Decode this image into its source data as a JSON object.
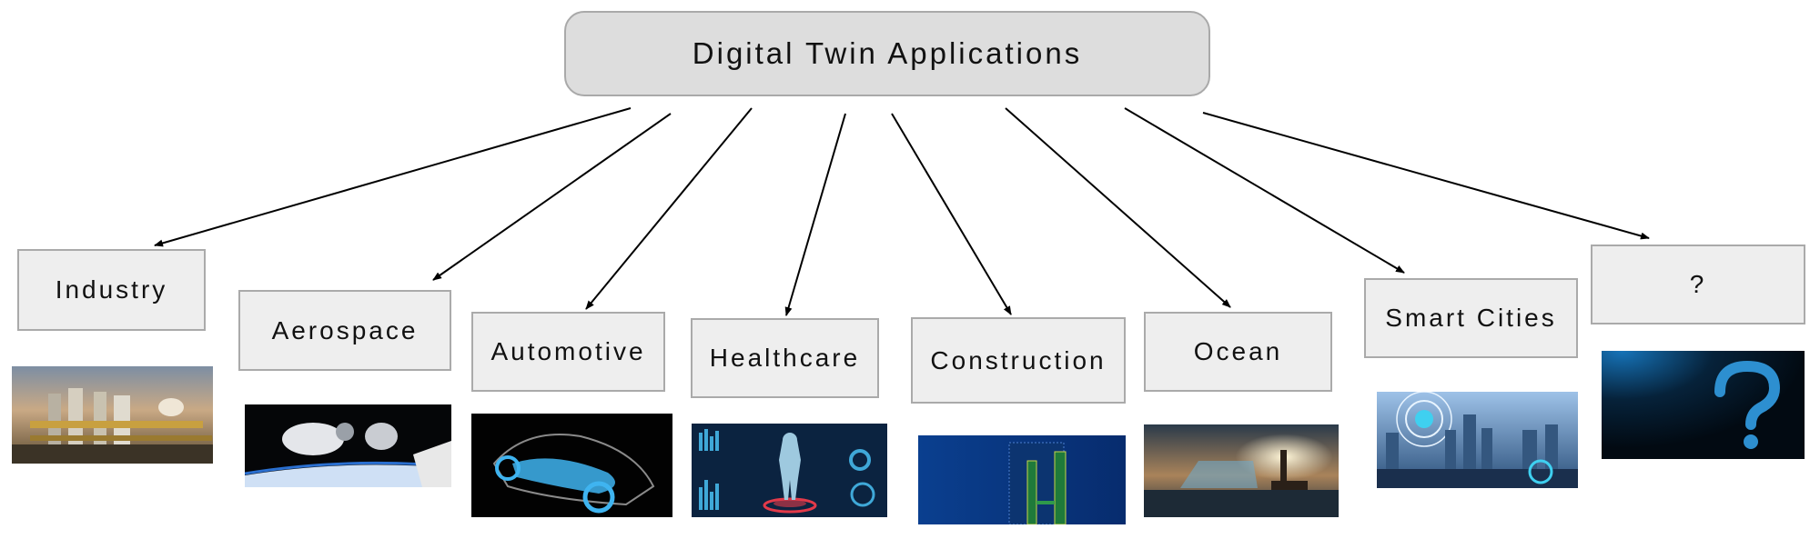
{
  "diagram": {
    "root": {
      "label": "Digital Twin Applications"
    },
    "children": [
      {
        "id": "industry",
        "label": "Industry",
        "image": "industrial-plant-photo"
      },
      {
        "id": "aerospace",
        "label": "Aerospace",
        "image": "spacecraft-docking-photo"
      },
      {
        "id": "automotive",
        "label": "Automotive",
        "image": "transparent-car-xray-render"
      },
      {
        "id": "healthcare",
        "label": "Healthcare",
        "image": "human-body-hologram-dashboard"
      },
      {
        "id": "construction",
        "label": "Construction",
        "image": "skyscraper-wireframe-render"
      },
      {
        "id": "ocean",
        "label": "Ocean",
        "image": "digital-ship-lighthouse-photo"
      },
      {
        "id": "smart-cities",
        "label": "Smart Cities",
        "image": "connected-city-skyline-photo"
      },
      {
        "id": "unknown",
        "label": "?",
        "image": "question-mark-graphic"
      }
    ],
    "edges": [
      {
        "from": "root",
        "to": "industry"
      },
      {
        "from": "root",
        "to": "aerospace"
      },
      {
        "from": "root",
        "to": "automotive"
      },
      {
        "from": "root",
        "to": "healthcare"
      },
      {
        "from": "root",
        "to": "construction"
      },
      {
        "from": "root",
        "to": "ocean"
      },
      {
        "from": "root",
        "to": "smart-cities"
      },
      {
        "from": "root",
        "to": "unknown"
      }
    ]
  },
  "colors": {
    "root_fill": "#dddddd",
    "node_fill": "#eeeeee",
    "border": "#aaaaaa",
    "arrow": "#000000"
  }
}
